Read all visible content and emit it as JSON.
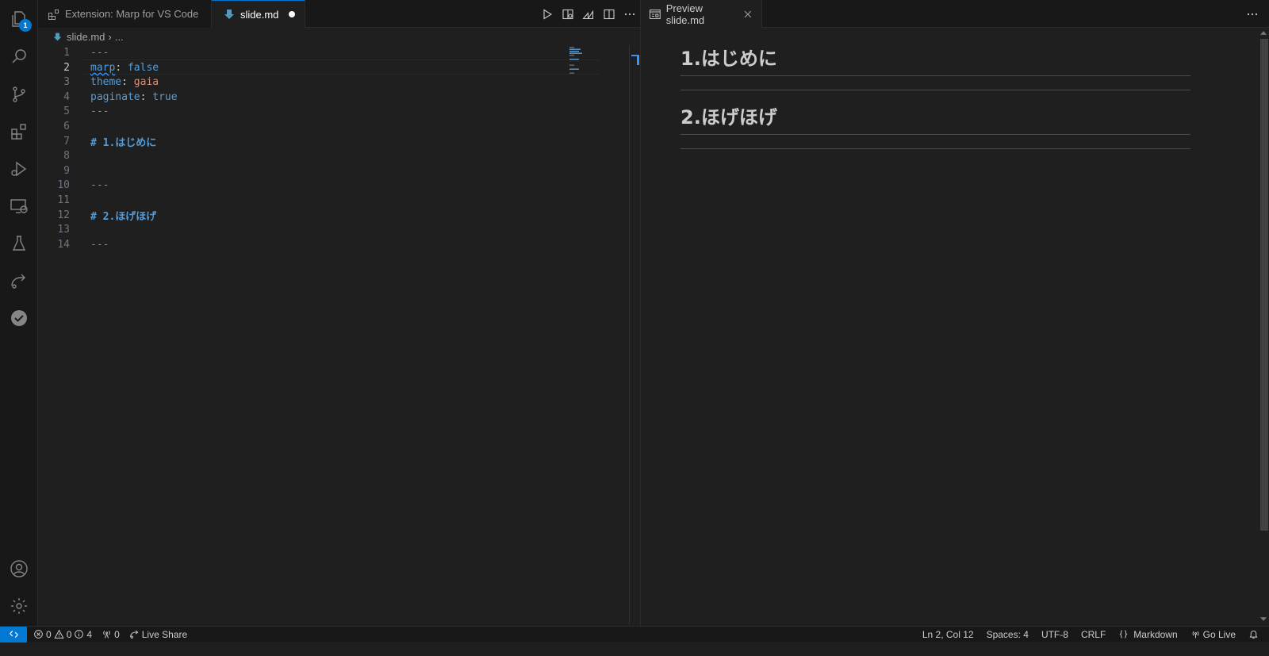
{
  "activity_bar": {
    "explorer_badge": "1",
    "items": [
      "explorer",
      "search",
      "source-control",
      "extensions",
      "run-debug",
      "remote-explorer",
      "testing",
      "live-share",
      "todo"
    ],
    "bottom": [
      "accounts",
      "manage"
    ]
  },
  "group1": {
    "tabs": [
      {
        "label": "Extension: Marp for VS Code",
        "icon": "extensions-icon",
        "active": false
      },
      {
        "label": "slide.md",
        "icon": "markdown-icon",
        "active": true,
        "dirty": true
      }
    ],
    "toolbar": [
      "run-icon",
      "open-preview-to-side-icon",
      "marp-icon",
      "split-editor-icon",
      "more-actions-icon"
    ],
    "breadcrumb": {
      "file": "slide.md",
      "sep": "›",
      "rest": "..."
    },
    "lines": [
      {
        "n": "1",
        "text": "---"
      },
      {
        "n": "2",
        "key": "marp",
        "colon": ": ",
        "val": "false"
      },
      {
        "n": "3",
        "key": "theme",
        "colon": ": ",
        "val": "gaia"
      },
      {
        "n": "4",
        "key": "paginate",
        "colon": ": ",
        "val": "true"
      },
      {
        "n": "5",
        "text": "---"
      },
      {
        "n": "6",
        "text": ""
      },
      {
        "n": "7",
        "heading": "# 1.はじめに"
      },
      {
        "n": "8",
        "text": ""
      },
      {
        "n": "9",
        "text": ""
      },
      {
        "n": "10",
        "text": "---"
      },
      {
        "n": "11",
        "text": ""
      },
      {
        "n": "12",
        "heading": "# 2.ほげほげ"
      },
      {
        "n": "13",
        "text": ""
      },
      {
        "n": "14",
        "text": "---"
      }
    ],
    "current_line": "2"
  },
  "group2": {
    "tab": {
      "label": "Preview slide.md",
      "icon": "preview-icon"
    },
    "headings": [
      "1.はじめに",
      "2.ほげほげ"
    ]
  },
  "statusbar": {
    "errors": "0",
    "warnings": "0",
    "infos": "4",
    "ports": "0",
    "live_share": "Live Share",
    "position": "Ln 2, Col 12",
    "spaces": "Spaces: 4",
    "encoding": "UTF-8",
    "eol": "CRLF",
    "language": "Markdown",
    "go_live": "Go Live"
  },
  "colors": {
    "accent": "#0078d4",
    "keyword": "#569cd6",
    "string": "#ce9178"
  }
}
